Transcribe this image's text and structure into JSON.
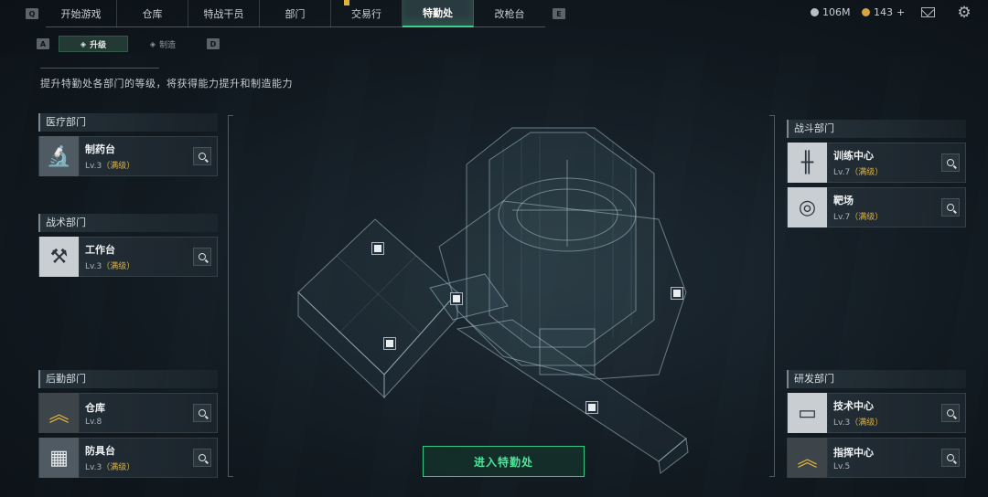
{
  "nav": {
    "left_key": "Q",
    "right_key": "E",
    "tabs": [
      {
        "label": "开始游戏",
        "active": false
      },
      {
        "label": "仓库",
        "active": false
      },
      {
        "label": "特战干员",
        "active": false
      },
      {
        "label": "部门",
        "active": false
      },
      {
        "label": "交易行",
        "active": false
      },
      {
        "label": "特勤处",
        "active": true
      },
      {
        "label": "改枪台",
        "active": false
      }
    ]
  },
  "resources": {
    "coins": "106M",
    "tickets": "143",
    "tickets_add": "+"
  },
  "subnav": {
    "left_key": "A",
    "right_key": "D",
    "tabs": [
      {
        "label": "升级",
        "active": true
      },
      {
        "label": "制造",
        "active": false
      }
    ]
  },
  "description": "提升特勤处各部门的等级，将获得能力提升和制造能力",
  "departments": {
    "medical": {
      "title": "医疗部门",
      "items": [
        {
          "name": "制药台",
          "level": "Lv.3",
          "status": "（满级）",
          "icon": "microscope-icon"
        }
      ]
    },
    "tactical": {
      "title": "战术部门",
      "items": [
        {
          "name": "工作台",
          "level": "Lv.3",
          "status": "（满级）",
          "icon": "hammer-wrench-icon"
        }
      ]
    },
    "logistics": {
      "title": "后勤部门",
      "items": [
        {
          "name": "仓库",
          "level": "Lv.8",
          "status": "",
          "icon": "chevron-rank-icon"
        },
        {
          "name": "防具台",
          "level": "Lv.3",
          "status": "（满级）",
          "icon": "cubes-icon"
        }
      ]
    },
    "combat": {
      "title": "战斗部门",
      "items": [
        {
          "name": "训练中心",
          "level": "Lv.7",
          "status": "（满级）",
          "icon": "dumbbell-icon"
        },
        {
          "name": "靶场",
          "level": "Lv.7",
          "status": "（满级）",
          "icon": "target-icon"
        }
      ]
    },
    "research": {
      "title": "研发部门",
      "items": [
        {
          "name": "技术中心",
          "level": "Lv.3",
          "status": "（满级）",
          "icon": "computer-icon"
        },
        {
          "name": "指挥中心",
          "level": "Lv.5",
          "status": "",
          "icon": "command-rank-icon"
        }
      ]
    }
  },
  "enter_button": "进入特勤处",
  "colors": {
    "accent_green": "#3ed08a",
    "max_level_gold": "#d9b24a",
    "background": "#121a21"
  }
}
